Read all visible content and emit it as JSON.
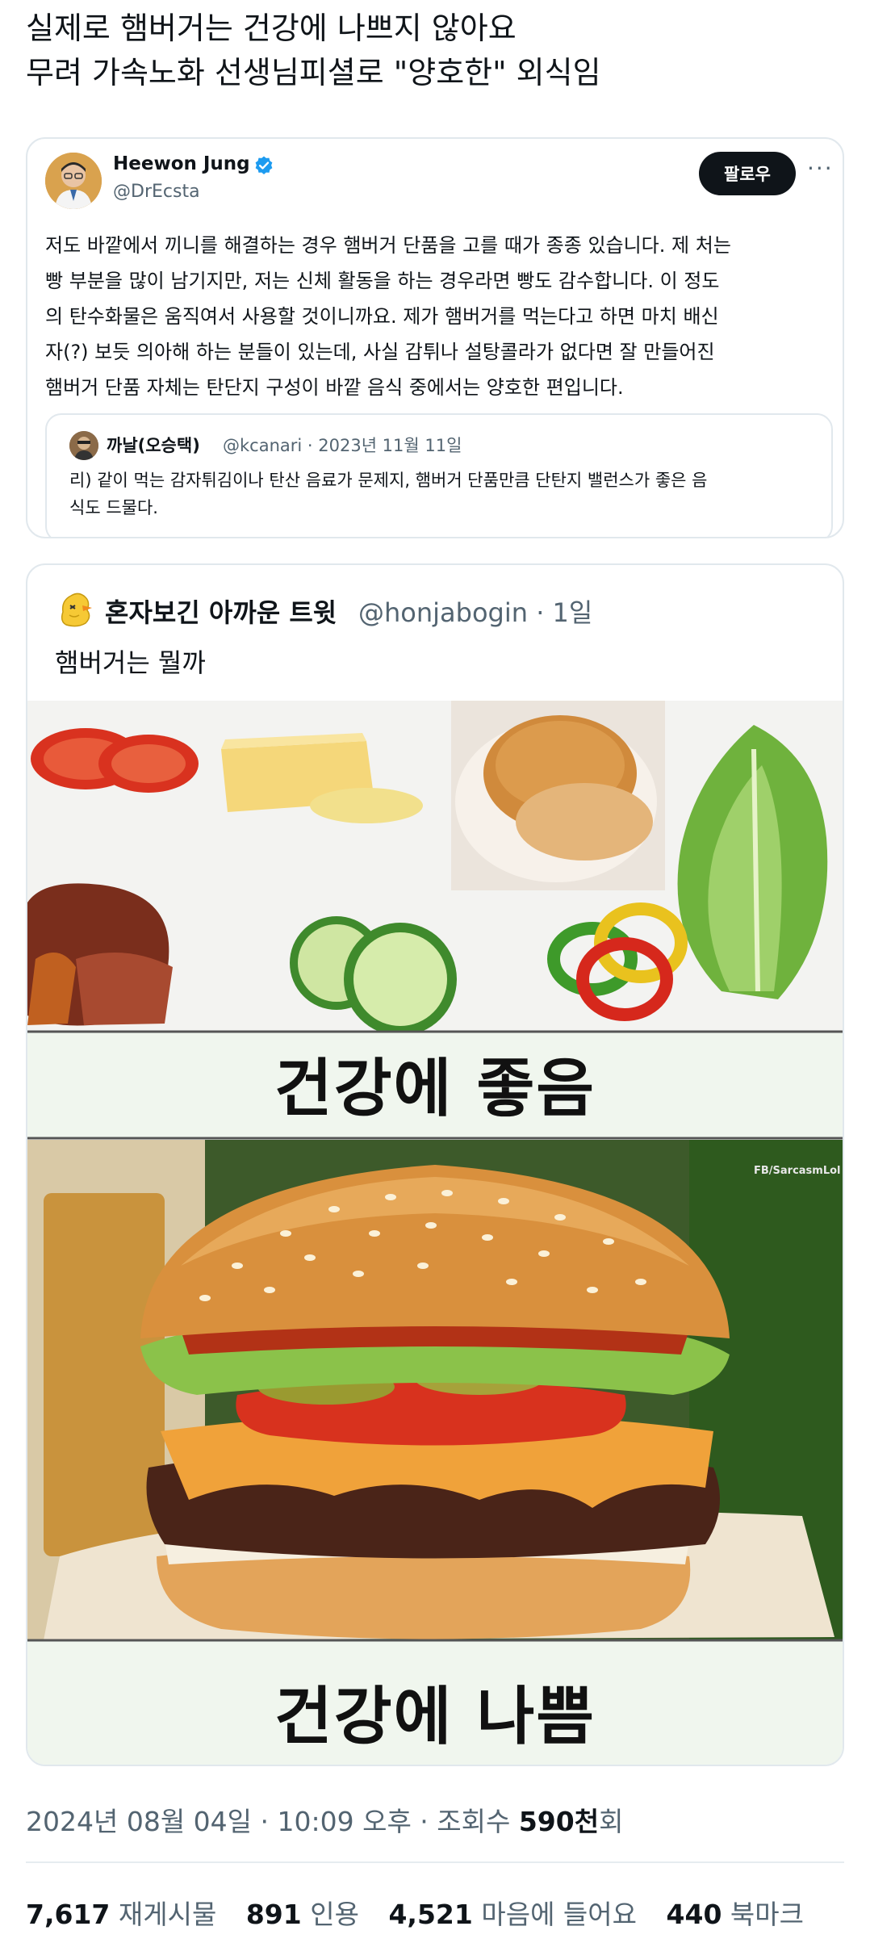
{
  "post": {
    "line1": "실제로 햄버거는 건강에 나쁘지 않아요",
    "line2": "무려 가속노화 선생님피셜로 \"양호한\" 외식임"
  },
  "main_tweet": {
    "author_name": "Heewon Jung",
    "author_handle": "@DrEcsta",
    "follow_label": "팔로우",
    "more_icon": "···",
    "body_lines": [
      "저도 바깥에서 끼니를 해결하는 경우 햄버거 단품을 고를 때가 종종 있습니다. 제 처는",
      "빵 부분을 많이 남기지만, 저는 신체 활동을 하는 경우라면 빵도 감수합니다. 이 정도",
      "의 탄수화물은 움직여서 사용할 것이니까요. 제가 햄버거를 먹는다고 하면 마치 배신",
      "자(?) 보듯 의아해 하는 분들이 있는데, 사실 감튀나 설탕콜라가 없다면 잘 만들어진",
      "햄버거 단품 자체는 탄단지 구성이 바깥 음식 중에서는 양호한 편입니다."
    ],
    "quote": {
      "author_name": "까날(오승택)",
      "handle_date": "@kcanari · 2023년 11월 11일",
      "body_lines": [
        "리) 같이 먹는 감자튀김이나 탄산 음료가 문제지, 햄버거 단품만큼 단탄지 밸런스가 좋은 음",
        "식도 드물다."
      ]
    }
  },
  "embedded_tweet": {
    "author_name": "혼자보긴 아까운 트윗",
    "handle_time": "@honjabogin · 1일",
    "text": "햄버거는 뭘까",
    "meme": {
      "label_top": "건강에 좋음",
      "label_bottom": "건강에 나쁨",
      "watermark": "FB/SarcasmLol"
    }
  },
  "meta": {
    "timestamp": "2024년 08월 04일 · 10:09 오후 · 조회수 ",
    "views": "590천",
    "views_suffix": "회"
  },
  "stats": [
    {
      "count": "7,617",
      "label": "재게시물"
    },
    {
      "count": "891",
      "label": "인용"
    },
    {
      "count": "4,521",
      "label": "마음에 들어요"
    },
    {
      "count": "440",
      "label": "북마크"
    }
  ],
  "colors": {
    "verified": "#1d9bf0",
    "secondary_text": "#536471",
    "follow_bg": "#0f1419"
  },
  "icons": [
    "verified-badge-icon",
    "more-options-icon",
    "avatar-icon",
    "duck-avatar-icon"
  ]
}
